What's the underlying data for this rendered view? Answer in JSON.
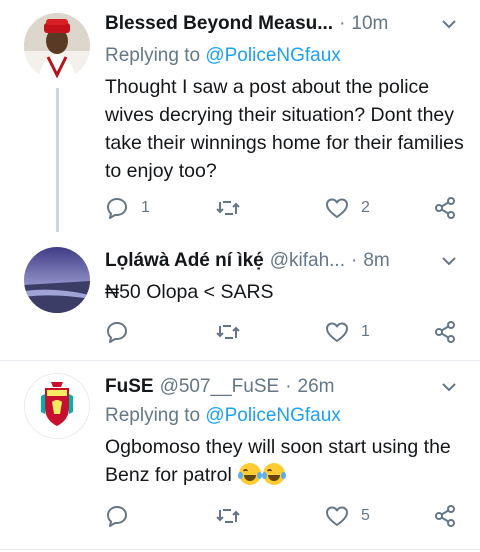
{
  "colors": {
    "link": "#1da1f2",
    "muted": "#657786",
    "text": "#14171a",
    "like": "#657786"
  },
  "tweets": [
    {
      "name": "Blessed Beyond Measu...",
      "handle": "",
      "time": "10m",
      "reply_prefix": "Replying to ",
      "reply_mention": "@PoliceNGfaux",
      "text": "Thought I saw a post about the police wives decrying their situation? Dont they take their winnings home for their families to enjoy too?",
      "reply_count": "1",
      "retweet_count": "",
      "like_count": "2",
      "avatar_icon": "man-in-red-cap-avatar"
    },
    {
      "name": "Lọláwà Adé ní ìkẹ́",
      "handle": "@kifah...",
      "time": "8m",
      "reply_prefix": "",
      "reply_mention": "",
      "text": "₦50 Olopa <  SARS",
      "reply_count": "",
      "retweet_count": "",
      "like_count": "1",
      "avatar_icon": "purple-sky-landscape-avatar"
    },
    {
      "name": "FuSE",
      "handle": "@507__FuSE",
      "time": "26m",
      "reply_prefix": "Replying to ",
      "reply_mention": "@PoliceNGfaux",
      "text": "Ogbomoso they will soon start using the Benz for patrol",
      "reply_count": "",
      "retweet_count": "",
      "like_count": "5",
      "avatar_icon": "liverpool-crest-avatar",
      "emojis": [
        "face-with-tears-of-joy",
        "face-with-tears-of-joy"
      ]
    }
  ]
}
